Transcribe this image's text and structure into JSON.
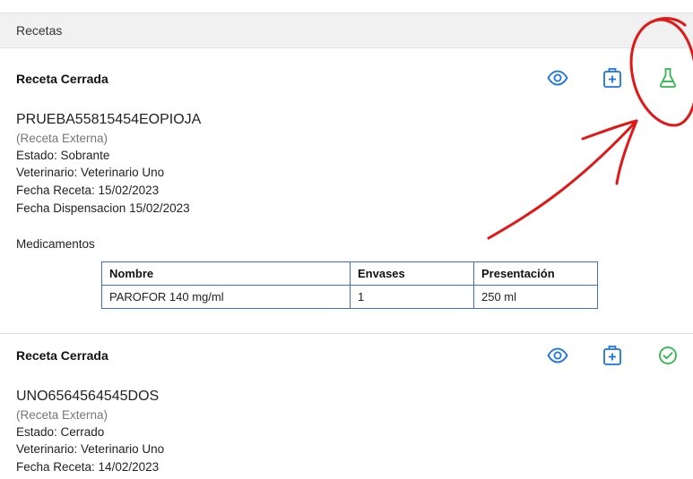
{
  "header": {
    "title": "Recetas"
  },
  "recetas": [
    {
      "title": "Receta Cerrada",
      "code": "PRUEBA55815454EOPIOJA",
      "tipo": "(Receta Externa)",
      "estado": "Estado: Sobrante",
      "veterinario": "Veterinario: Veterinario Uno",
      "fecha_receta": "Fecha Receta: 15/02/2023",
      "fecha_dispensacion": "Fecha Dispensacion 15/02/2023",
      "medicamentos_label": "Medicamentos",
      "medicamentos": {
        "headers": [
          "Nombre",
          "Envases",
          "Presentación"
        ],
        "rows": [
          [
            "PAROFOR 140 mg/ml",
            "1",
            "250 ml"
          ]
        ]
      },
      "status_icon": "flask-icon"
    },
    {
      "title": "Receta Cerrada",
      "code": "UNO6564564545DOS",
      "tipo": "(Receta Externa)",
      "estado": "Estado: Cerrado",
      "veterinario": "Veterinario: Veterinario Uno",
      "fecha_receta": "Fecha Receta: 14/02/2023",
      "status_icon": "check-circle-icon"
    }
  ],
  "colors": {
    "accent_blue": "#1a73e8",
    "success_green": "#2db84d",
    "annotation_red": "#e01818",
    "table_border": "#3b6fd6"
  }
}
